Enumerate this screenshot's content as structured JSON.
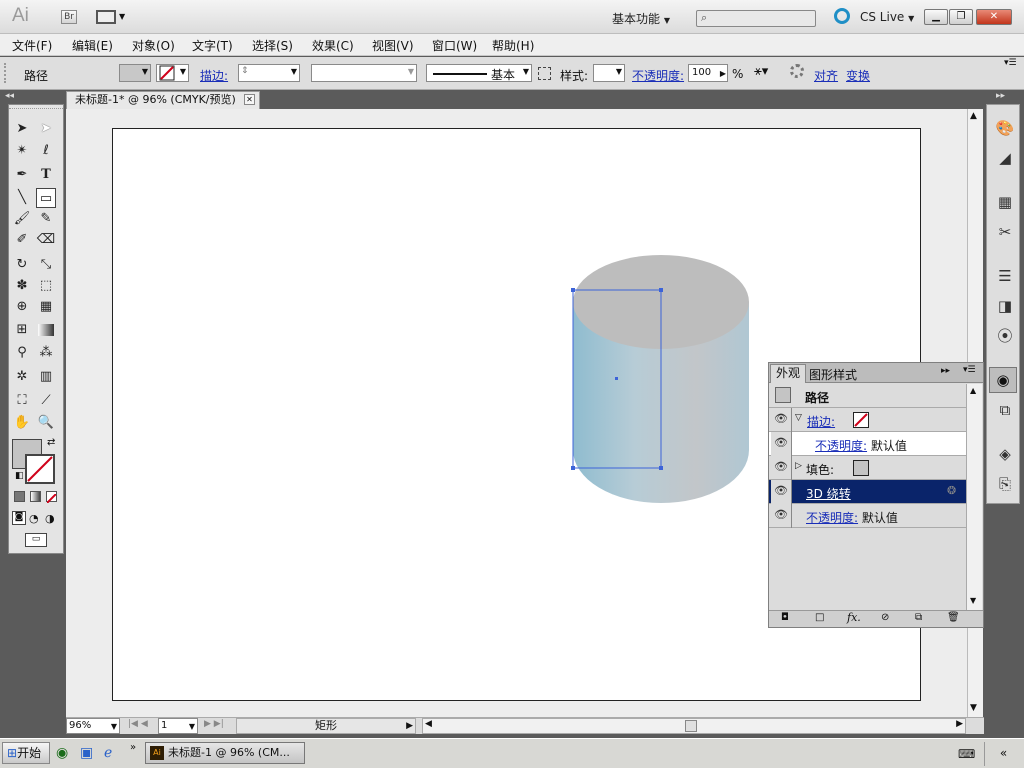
{
  "app": {
    "logo": "Ai",
    "bridge": "Br",
    "workspace": "基本功能",
    "cs_live": "CS Live"
  },
  "menu": [
    "文件(F)",
    "编辑(E)",
    "对象(O)",
    "文字(T)",
    "选择(S)",
    "效果(C)",
    "视图(V)",
    "窗口(W)",
    "帮助(H)"
  ],
  "control": {
    "selection": "路径",
    "stroke_label": "描边:",
    "profile": "基本",
    "style_label": "样式:",
    "opacity_label": "不透明度:",
    "opacity_value": "100",
    "percent": "%",
    "align": "对齐",
    "transform": "变换"
  },
  "document": {
    "tab_title": "未标题-1* @ 96% (CMYK/预览)"
  },
  "status": {
    "zoom": "96%",
    "page": "1",
    "tool": "矩形"
  },
  "appearance": {
    "tabs": [
      "外观",
      "图形样式"
    ],
    "header": "路径",
    "rows": [
      {
        "label": "描边:",
        "kind": "stroke"
      },
      {
        "label": "不透明度:",
        "value": "默认值",
        "kind": "sub"
      },
      {
        "label": "填色:",
        "kind": "fill"
      },
      {
        "label": "3D 绕转",
        "kind": "effect"
      },
      {
        "label": "不透明度:",
        "value": "默认值",
        "kind": "opacity"
      }
    ]
  },
  "colors": {
    "selection": "#3c63d8",
    "cylinder_side_light": "#a9c6d6",
    "cylinder_top": "#bdbdbd",
    "highlight_row": "#0a246a"
  },
  "taskbar": {
    "start": "开始",
    "task": "未标题-1 @ 96% (CM..."
  }
}
